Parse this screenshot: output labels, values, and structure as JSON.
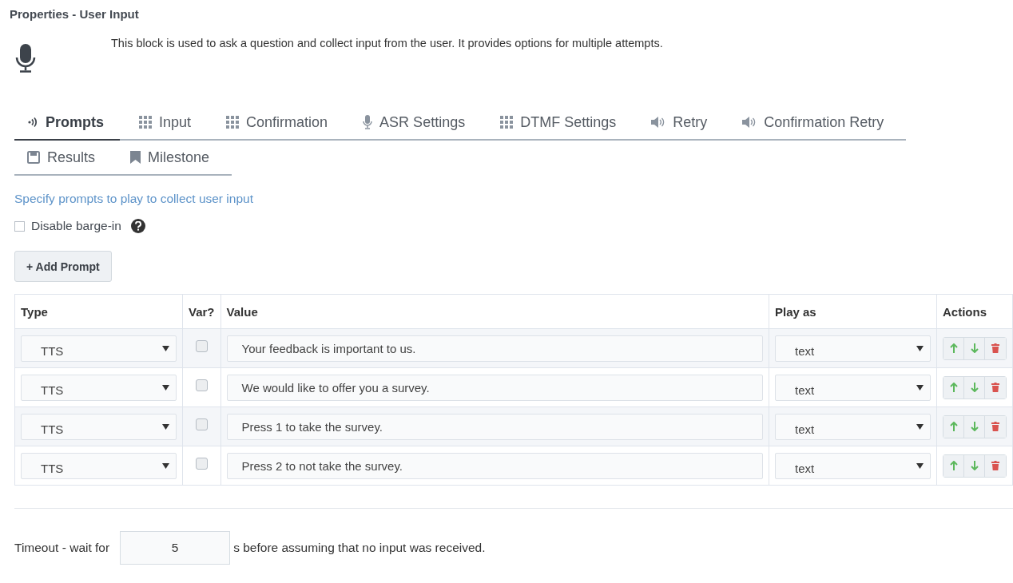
{
  "title": "Properties - User Input",
  "description": "This block is used to ask a question and collect input from the user. It provides options for multiple attempts.",
  "tab_rows": [
    [
      {
        "label": "Prompts",
        "kind": "wave",
        "selected": true
      },
      {
        "label": "Input",
        "kind": "grid",
        "selected": false
      },
      {
        "label": "Confirmation",
        "kind": "grid",
        "selected": false
      },
      {
        "label": "ASR Settings",
        "kind": "mic",
        "selected": false
      },
      {
        "label": "DTMF Settings",
        "kind": "grid",
        "selected": false
      },
      {
        "label": "Retry",
        "kind": "speaker",
        "selected": false
      },
      {
        "label": "Confirmation Retry",
        "kind": "speaker",
        "selected": false
      }
    ],
    [
      {
        "label": "Results",
        "kind": "save",
        "selected": false
      },
      {
        "label": "Milestone",
        "kind": "bookmark",
        "selected": false
      }
    ]
  ],
  "section_hint": "Specify prompts to play to collect user input",
  "disable_barge_in": {
    "label": "Disable barge-in",
    "checked": false
  },
  "add_button": "+ Add Prompt",
  "table": {
    "columns": [
      "Type",
      "Var?",
      "Value",
      "Play as",
      "Actions"
    ],
    "rows": [
      {
        "type": "TTS",
        "var": false,
        "value": "Your feedback is important to us.",
        "play_as": "text"
      },
      {
        "type": "TTS",
        "var": false,
        "value": "We would like to offer you a survey.",
        "play_as": "text"
      },
      {
        "type": "TTS",
        "var": false,
        "value": "Press 1 to take the survey.",
        "play_as": "text"
      },
      {
        "type": "TTS",
        "var": false,
        "value": "Press 2 to not take the survey.",
        "play_as": "text"
      }
    ]
  },
  "timeout": {
    "before": "Timeout - wait for",
    "value": "5",
    "after": "s before assuming that no input was received."
  }
}
